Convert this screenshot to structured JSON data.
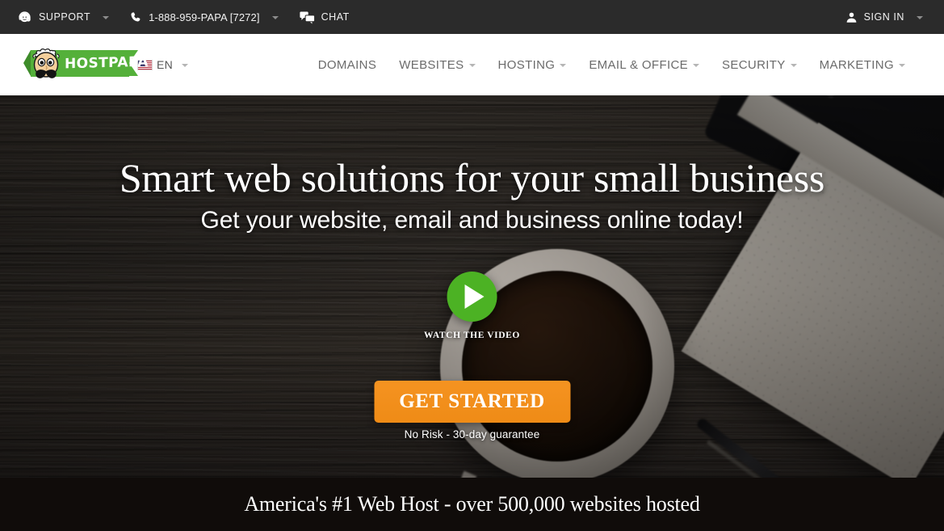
{
  "topbar": {
    "support_label": "SUPPORT",
    "phone": "1-888-959-PAPA [7272]",
    "chat_label": "CHAT",
    "signin_label": "SIGN IN",
    "background_color": "#2b2b2b"
  },
  "header": {
    "logo_text": "HOSTPAPA",
    "logo_green": "#54b03a",
    "language": "EN",
    "nav": [
      {
        "label": "DOMAINS",
        "has_caret": false
      },
      {
        "label": "WEBSITES",
        "has_caret": true
      },
      {
        "label": "HOSTING",
        "has_caret": true
      },
      {
        "label": "EMAIL & OFFICE",
        "has_caret": true
      },
      {
        "label": "SECURITY",
        "has_caret": true
      },
      {
        "label": "MARKETING",
        "has_caret": true
      }
    ]
  },
  "hero": {
    "headline": "Smart web solutions for your small business",
    "subheadline": "Get your website, email and business online today!",
    "video_label": "WATCH THE VIDEO",
    "cta_label": "GET STARTED",
    "cta_subtext": "No Risk - 30-day guarantee",
    "play_button_color": "#4cb224",
    "cta_color": "#f59321"
  },
  "banner": {
    "text": "America's #1 Web Host - over 500,000 websites hosted",
    "background_color": "#100c0a"
  }
}
